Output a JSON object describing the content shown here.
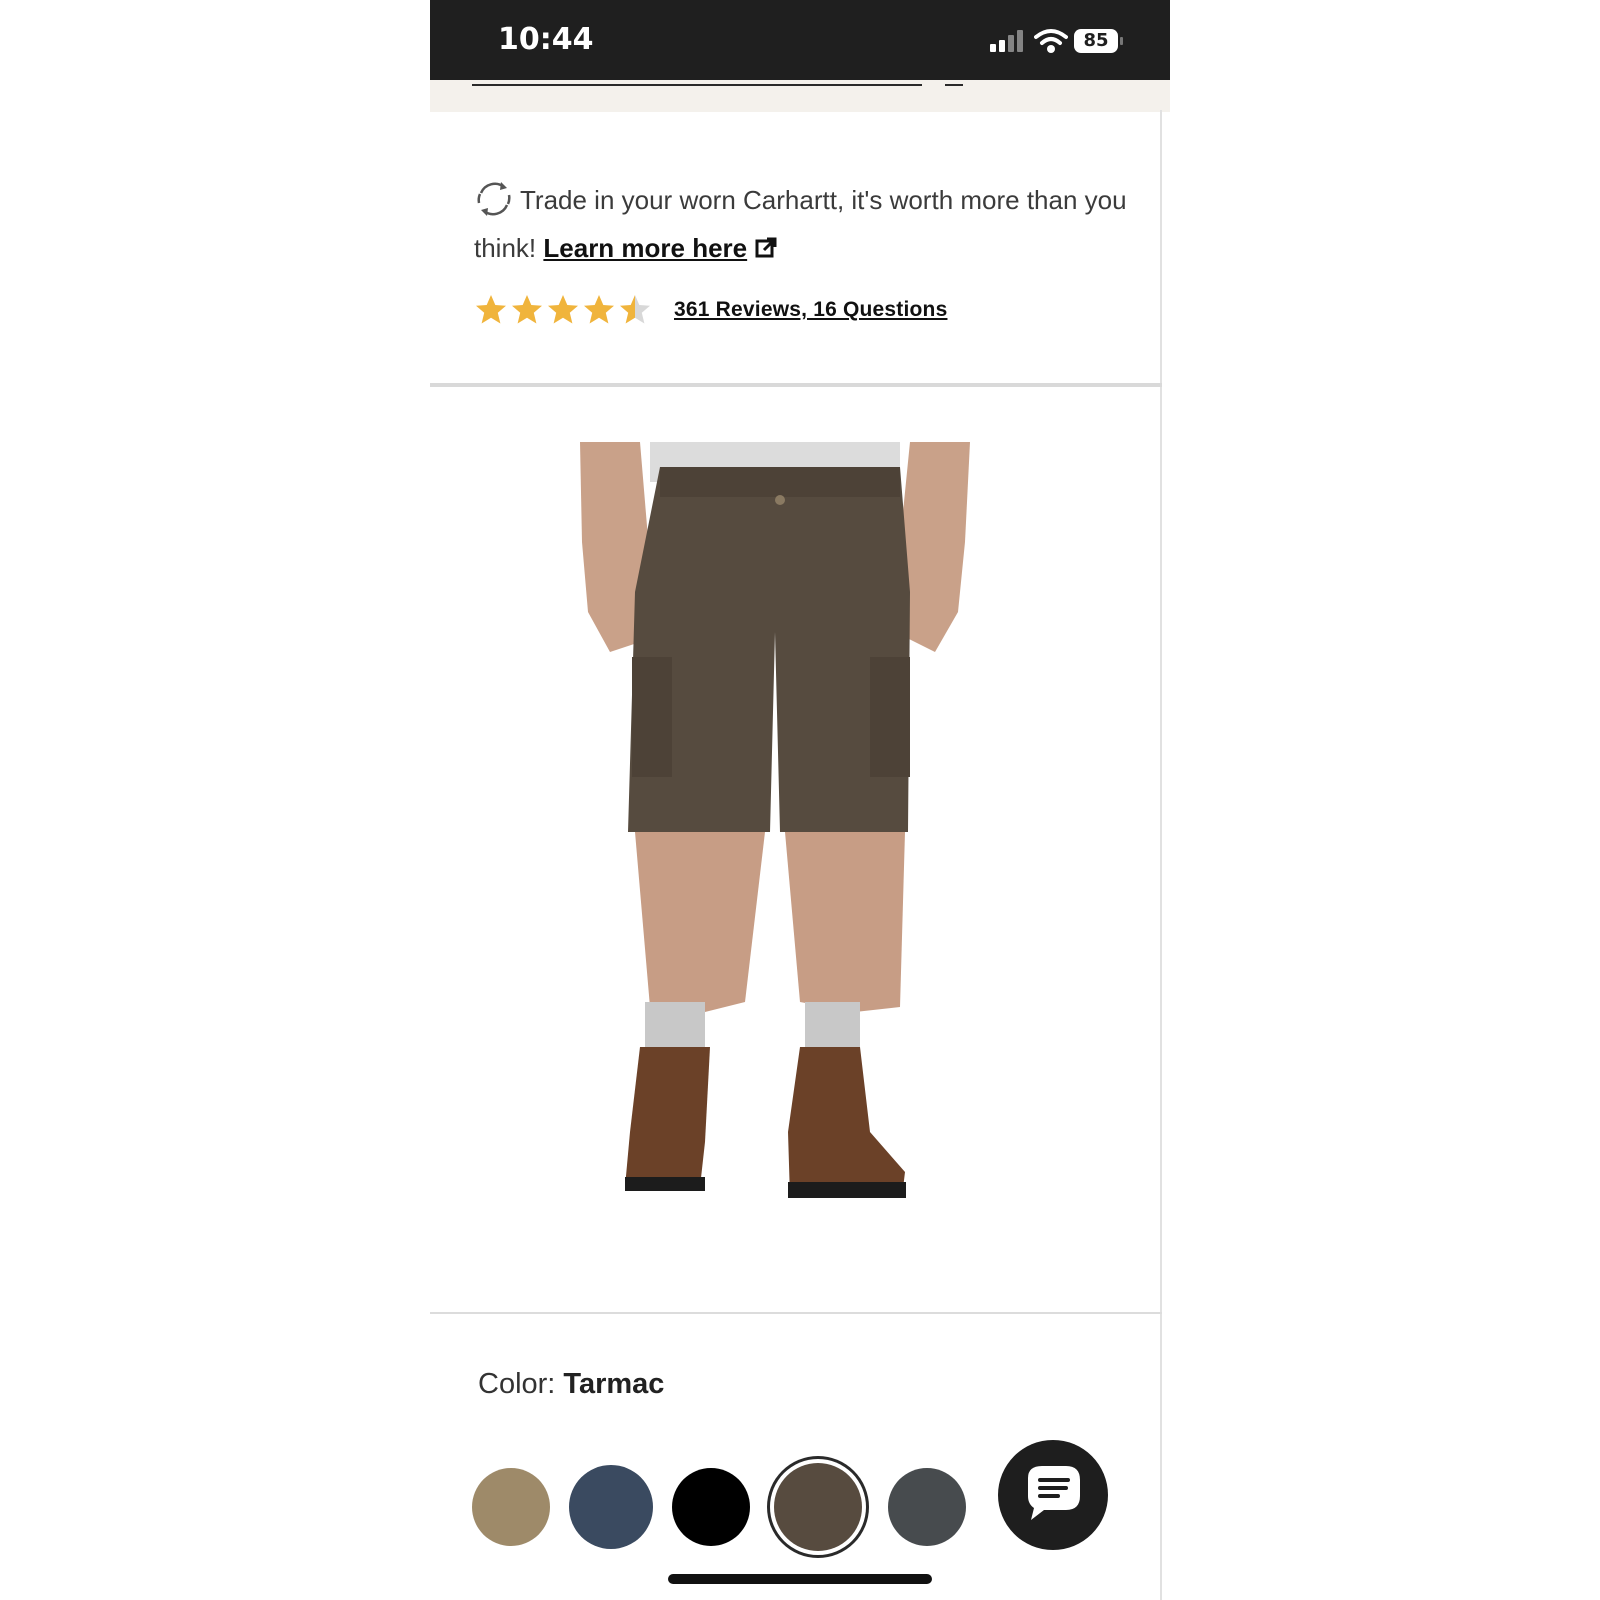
{
  "status_bar": {
    "time": "10:44",
    "battery": "85"
  },
  "trade_in": {
    "text": "Trade in your worn Carhartt, it's worth more than you think!",
    "link": "Learn more here"
  },
  "rating": {
    "stars": 4.5,
    "star_color": "#f0b43c",
    "reviews_link": "361 Reviews, 16 Questions"
  },
  "product": {
    "image_alt": "Cargo shorts in Tarmac worn with work boots"
  },
  "color": {
    "label": "Color:",
    "value": "Tarmac",
    "swatches": [
      {
        "name": "khaki",
        "hex": "#9e8a69",
        "selected": false
      },
      {
        "name": "navy",
        "hex": "#3a4a60",
        "selected": false
      },
      {
        "name": "black",
        "hex": "#000000",
        "selected": false
      },
      {
        "name": "tarmac",
        "hex": "#574b3f",
        "selected": true
      },
      {
        "name": "gravel",
        "hex": "#474b4e",
        "selected": false
      }
    ]
  },
  "icons": {
    "chat": "chat-bubble-icon",
    "recycle": "recycle-icon",
    "external": "external-link-icon"
  }
}
